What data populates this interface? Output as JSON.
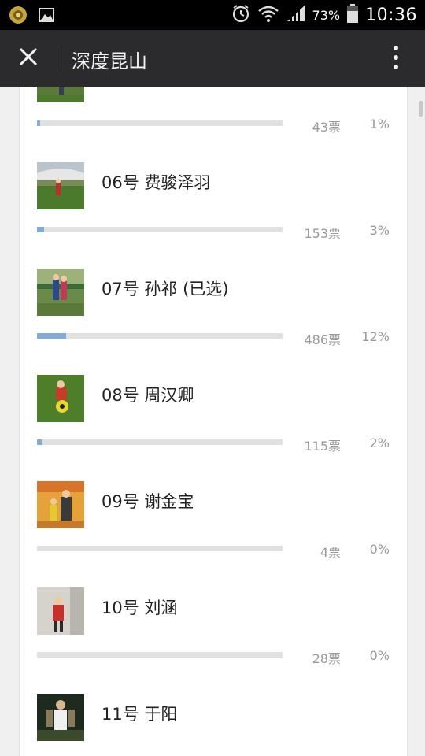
{
  "status_bar": {
    "battery_percent": "73%",
    "time": "10:36",
    "icons": [
      "app-notification-icon",
      "gallery-icon",
      "alarm-icon",
      "wifi-icon",
      "signal-icon",
      "battery-icon"
    ]
  },
  "title_bar": {
    "title": "深度昆山",
    "close_icon": "close-icon",
    "more_icon": "more-vertical-icon"
  },
  "entries": [
    {
      "name": "",
      "votes": "43票",
      "percent": "1%",
      "fill_fraction": 0.01,
      "thumb": "photo-field"
    },
    {
      "name": "06号 费骏泽羽",
      "votes": "153票",
      "percent": "3%",
      "fill_fraction": 0.03,
      "thumb": "photo-stadium"
    },
    {
      "name": "07号 孙祁 (已选)",
      "votes": "486票",
      "percent": "12%",
      "fill_fraction": 0.12,
      "thumb": "photo-boys"
    },
    {
      "name": "08号 周汉卿",
      "votes": "115票",
      "percent": "2%",
      "fill_fraction": 0.02,
      "thumb": "photo-ball"
    },
    {
      "name": "09号 谢金宝",
      "votes": "4票",
      "percent": "0%",
      "fill_fraction": 0.0,
      "thumb": "photo-poster"
    },
    {
      "name": "10号 刘涵",
      "votes": "28票",
      "percent": "0%",
      "fill_fraction": 0.0,
      "thumb": "photo-room"
    },
    {
      "name": "11号 于阳",
      "votes": "",
      "percent": "",
      "fill_fraction": 0.0,
      "thumb": "photo-night"
    }
  ],
  "colors": {
    "bar_fill": "#7fadd8",
    "bar_track": "#e1e1e1",
    "title_bar": "#2b2b2e"
  }
}
